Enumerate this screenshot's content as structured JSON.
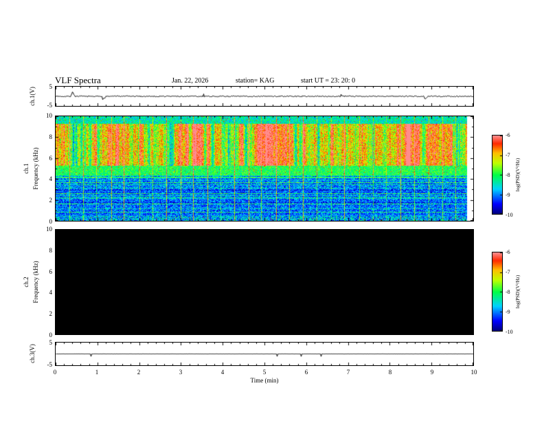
{
  "header": {
    "title": "VLF Spectra",
    "date": "Jan. 22, 2026",
    "station": "station= KAG",
    "start_ut": "start UT =  23: 20: 0"
  },
  "chart_data": {
    "type": "heatmap",
    "title": "VLF Spectra",
    "layout": "4 stacked panels sharing a common time axis",
    "x": {
      "label": "Time (min)",
      "range": [
        0,
        10
      ],
      "ticks": [
        0,
        1,
        2,
        3,
        4,
        5,
        6,
        7,
        8,
        9,
        10
      ],
      "minor_tick_step": 0.2
    },
    "panels": [
      {
        "id": "ch1_waveform",
        "type": "line",
        "ylabel": "ch.1(V)",
        "ylim": [
          -5,
          5
        ],
        "ytick_labels": [
          "5",
          "-5"
        ],
        "signal": {
          "baseline": 0,
          "noise_amplitude": 0.3,
          "spikes": [
            {
              "t": 0.4,
              "amp": 2.4
            },
            {
              "t": 1.15,
              "amp": -1.2
            },
            {
              "t": 8.85,
              "amp": -1.5
            }
          ]
        }
      },
      {
        "id": "ch1_spectrogram",
        "type": "heatmap",
        "row_label": "ch.1",
        "ylabel": "Frequency (kHz)",
        "ylim": [
          0,
          10
        ],
        "yticks": [
          0,
          2,
          4,
          6,
          8,
          10
        ],
        "data_end_min": 9.85,
        "psd_range": [
          -10,
          -6
        ],
        "bands": [
          {
            "freq_khz": [
              0,
              0.5
            ],
            "psd": -8.8,
            "variation": 0.8,
            "style": "mottled"
          },
          {
            "freq_khz": [
              0.5,
              3.2
            ],
            "psd": -9.1,
            "variation": 0.6,
            "style": "horizontal-banding"
          },
          {
            "freq_khz": [
              3.2,
              4.4
            ],
            "psd": -9.0,
            "variation": 0.6,
            "style": "horizontal-banding"
          },
          {
            "freq_khz": [
              4.4,
              5.3
            ],
            "psd": -8.0,
            "variation": 0.5,
            "style": "mottled"
          },
          {
            "freq_khz": [
              5.3,
              9.3
            ],
            "psd": -7.1,
            "variation": 0.7,
            "style": "vertical-streaks"
          },
          {
            "freq_khz": [
              9.3,
              10
            ],
            "psd": -8.4,
            "variation": 0.6,
            "style": "mottled"
          }
        ],
        "gridline_every_min": 0.33,
        "colorbar": {
          "label": "log(PSD)(V²/Hz)",
          "range": [
            -10,
            -6
          ],
          "ticks": [
            -6,
            -7,
            -8,
            -9,
            -10
          ]
        }
      },
      {
        "id": "ch2_spectrogram",
        "type": "heatmap",
        "row_label": "ch.2",
        "ylabel": "Frequency (kHz)",
        "ylim": [
          0,
          10
        ],
        "yticks": [
          0,
          2,
          4,
          6,
          8,
          10
        ],
        "no_data": true,
        "fill_color": "#000000",
        "colorbar": {
          "label": "log(PSD)(V²/Hz)",
          "range": [
            -10,
            -6
          ],
          "ticks": [
            -6,
            -7,
            -8,
            -9,
            -10
          ]
        }
      },
      {
        "id": "ch3_waveform",
        "type": "line",
        "ylabel": "ch.3(V)",
        "ylim": [
          -5,
          5
        ],
        "ytick_labels": [
          "5",
          "-5"
        ],
        "signal": {
          "baseline": 0,
          "noise_amplitude": 0.03,
          "spikes": []
        }
      }
    ],
    "colormap": "jet",
    "background": "#ffffff"
  }
}
